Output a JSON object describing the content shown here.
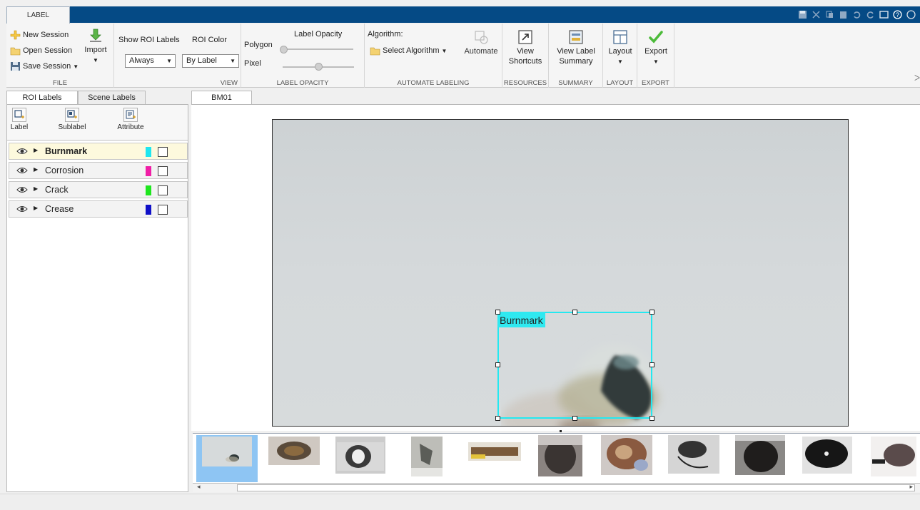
{
  "app": {
    "tab_label": "LABEL"
  },
  "ribbon": {
    "file": {
      "new_session": "New Session",
      "open_session": "Open Session",
      "save_session": "Save Session",
      "import": "Import",
      "title": "FILE"
    },
    "view": {
      "show_roi_labels": "Show ROI Labels",
      "show_roi_labels_value": "Always",
      "roi_color": "ROI Color",
      "roi_color_value": "By Label",
      "title": "VIEW"
    },
    "label_opacity": {
      "title_top": "Label Opacity",
      "polygon": "Polygon",
      "pixel": "Pixel",
      "title": "LABEL OPACITY"
    },
    "automate": {
      "algorithm": "Algorithm:",
      "select_algorithm": "Select Algorithm",
      "automate": "Automate",
      "title": "AUTOMATE LABELING"
    },
    "resources": {
      "view": "View",
      "shortcuts": "Shortcuts",
      "title": "RESOURCES"
    },
    "summary": {
      "view_label": "View Label",
      "summary": "Summary",
      "title": "SUMMARY"
    },
    "layout": {
      "label": "Layout",
      "title": "LAYOUT"
    },
    "export": {
      "label": "Export",
      "title": "EXPORT"
    },
    "collapse_glyph": "ᐳ"
  },
  "left": {
    "tabs": [
      "ROI Labels",
      "Scene Labels"
    ],
    "tools": [
      "Label",
      "Sublabel",
      "Attribute"
    ],
    "labels": [
      {
        "name": "Burnmark",
        "color": "#1ee6f0"
      },
      {
        "name": "Corrosion",
        "color": "#f01ea6"
      },
      {
        "name": "Crack",
        "color": "#1ee61e"
      },
      {
        "name": "Crease",
        "color": "#1010c8"
      }
    ]
  },
  "document": {
    "tab": "BM01",
    "roi_tag": "Burnmark"
  },
  "icons": {
    "eye": "eye-icon",
    "expand": "triangle-right-icon"
  }
}
